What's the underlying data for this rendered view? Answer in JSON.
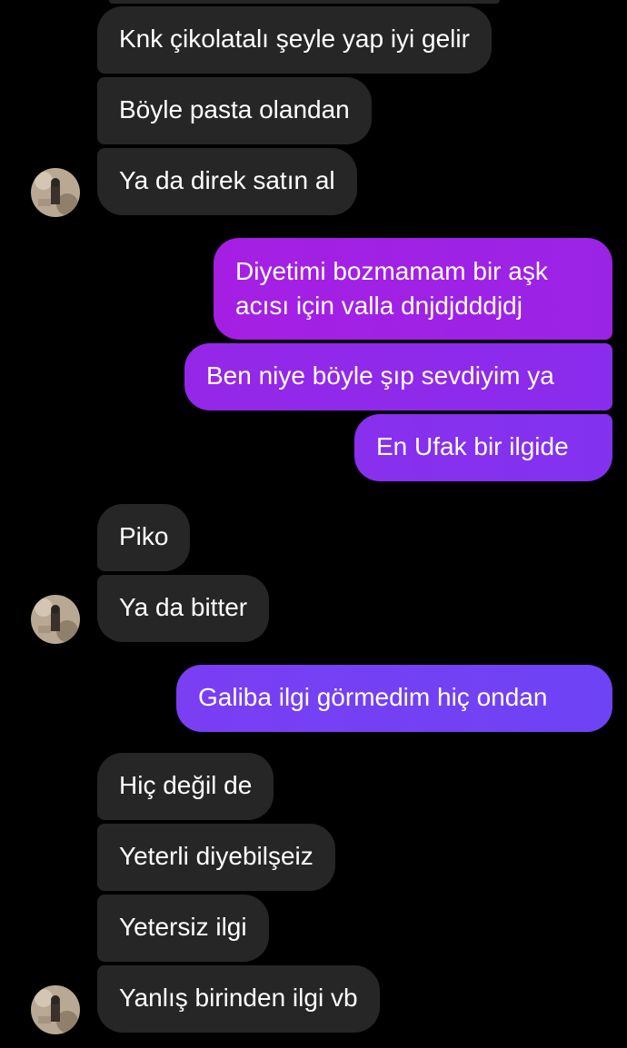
{
  "messages": {
    "in_1": "Knk çikolatalı şeyle yap iyi gelir",
    "in_2": "Böyle pasta olandan",
    "in_3": "Ya da direk satın al",
    "out_1_line1": "Diyetimi bozmamam bir aşk",
    "out_1_line2": "acısı için valla dnjdjdddjdj",
    "out_2": "Ben niye böyle şıp sevdiyim ya",
    "out_3": "En Ufak bir ilgide",
    "in_4": "Piko",
    "in_5": "Ya da bitter",
    "out_4": "Galiba ilgi görmedim hiç ondan",
    "in_6": "Hiç değil de",
    "in_7": "Yeterli diyebilşeiz",
    "in_8": "Yetersiz ilgi",
    "in_9": "Yanlış birinden ilgi vb"
  },
  "colors": {
    "background": "#000000",
    "incoming_bubble": "#262626",
    "outgoing_top": "#a01ee0",
    "outgoing_mid": "#8a2ff0",
    "outgoing_bottom": "#7040f5",
    "text": "#ffffff"
  },
  "icons": {
    "avatar": "contact-avatar-icon"
  }
}
